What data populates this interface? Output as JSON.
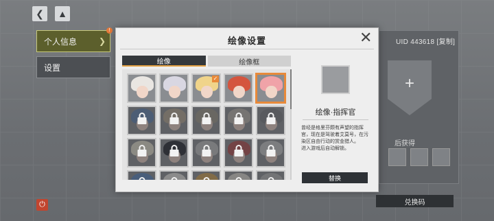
{
  "background": {
    "sidebar": [
      {
        "label": "个人信息",
        "active": true
      },
      {
        "label": "设置",
        "active": false
      }
    ],
    "uid_label": "UID",
    "uid_value": "443618",
    "uid_copy": "[复制]",
    "unlock_hint": "后获得",
    "redeem_button": "兑换码"
  },
  "modal": {
    "title": "绘像设置",
    "tabs": [
      {
        "label": "绘像",
        "active": true
      },
      {
        "label": "绘像框",
        "active": false
      }
    ],
    "avatars": [
      {
        "hair": "#e9e6e2",
        "locked": false,
        "selected": false
      },
      {
        "hair": "#d9d7e2",
        "locked": false,
        "selected": false
      },
      {
        "hair": "#f0d48a",
        "locked": false,
        "selected": false,
        "checked": true
      },
      {
        "hair": "#d4553e",
        "locked": false,
        "selected": false
      },
      {
        "hair": "#f0a3a8",
        "locked": false,
        "selected": true
      },
      {
        "hair": "#5f84b4",
        "locked": true
      },
      {
        "hair": "#b8a893",
        "locked": true
      },
      {
        "hair": "#a19a8b",
        "locked": true
      },
      {
        "hair": "#bdb7ad",
        "locked": true
      },
      {
        "hair": "#7a7c80",
        "locked": true
      },
      {
        "hair": "#ece7d2",
        "locked": true
      },
      {
        "hair": "#1e2028",
        "locked": true
      },
      {
        "hair": "#c4c4c4",
        "locked": true
      },
      {
        "hair": "#b64b4b",
        "locked": true
      },
      {
        "hair": "#c9c9c9",
        "locked": true
      },
      {
        "hair": "#5a85c2",
        "locked": true
      },
      {
        "hair": "#ece9e4",
        "locked": true
      },
      {
        "hair": "#d6a24f",
        "locked": true
      },
      {
        "hair": "#e2ddd4",
        "locked": true
      },
      {
        "hair": "#b7b7b7",
        "locked": true
      }
    ],
    "detail": {
      "title": "绘像·指挥官",
      "description": "曾经是格里芬颇有声望的指挥官，现在是驾驶着艾莫号，在污染区自由行动的赏金猎人。\n进入游戏后自动解锁。",
      "replace_button": "替换",
      "preview_hair": "#f0a3a8"
    }
  },
  "icons": {
    "back": "arrow-left-icon",
    "home": "home-icon",
    "close": "close-icon",
    "lock": "lock-icon",
    "check": "check-icon",
    "power": "power-icon"
  },
  "colors": {
    "accent": "#e88a3a",
    "button_dark": "#2e3236"
  }
}
